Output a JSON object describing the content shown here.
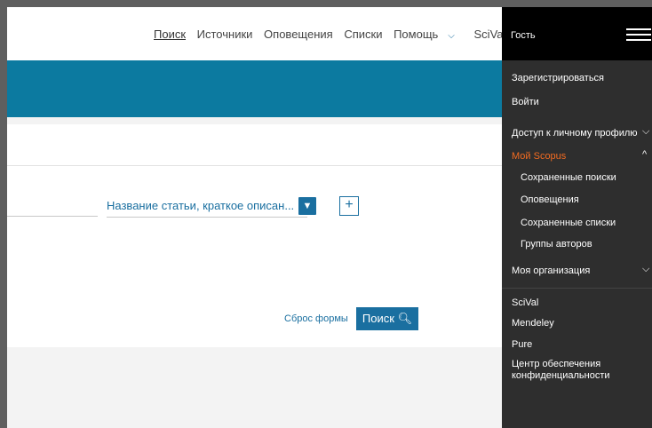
{
  "top_nav": {
    "links": [
      "Поиск",
      "Источники",
      "Оповещения",
      "Списки",
      "Помощь",
      "SciVal"
    ],
    "help_chevron_icon": "chevron-down-icon"
  },
  "form": {
    "field_select_value": "Название статьи, краткое описан...",
    "add_icon": "plus-icon",
    "reset_label": "Сброс формы",
    "search_label": "Поиск"
  },
  "side_panel": {
    "guest_label": "Гость",
    "register_label": "Зарегистрироваться",
    "login_label": "Войти",
    "profile_access_label": "Доступ к личному профилю",
    "my_scopus_label": "Мой Scopus",
    "my_scopus_items": [
      "Сохраненные поиски",
      "Оповещения",
      "Сохраненные списки",
      "Группы авторов"
    ],
    "my_org_label": "Моя организация",
    "product_links": [
      "SciVal",
      "Mendeley",
      "Pure"
    ],
    "privacy_center_label": "Центр обеспечения конфиденциальности",
    "accent_color": "#f26b21"
  },
  "colors": {
    "brand_blue": "#1a6fa0",
    "band_blue": "#0c7aa0",
    "panel_bg": "#2e2e2e"
  }
}
